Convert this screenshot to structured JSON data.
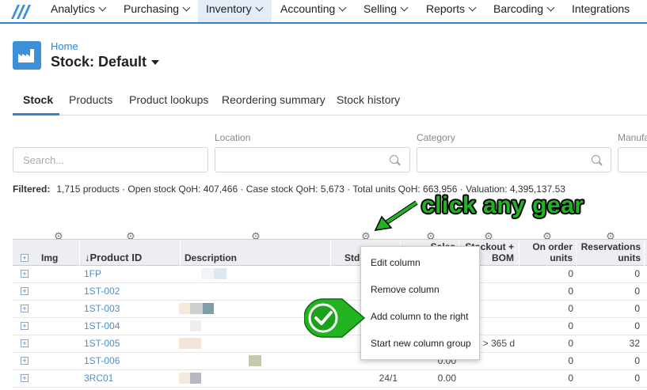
{
  "nav": {
    "items": [
      {
        "label": "Analytics"
      },
      {
        "label": "Purchasing"
      },
      {
        "label": "Inventory"
      },
      {
        "label": "Accounting"
      },
      {
        "label": "Selling"
      },
      {
        "label": "Reports"
      },
      {
        "label": "Barcoding"
      },
      {
        "label": "Integrations"
      }
    ]
  },
  "header": {
    "breadcrumb": "Home",
    "title": "Stock: Default"
  },
  "tabs": [
    {
      "label": "Stock"
    },
    {
      "label": "Products"
    },
    {
      "label": "Product lookups"
    },
    {
      "label": "Reordering summary"
    },
    {
      "label": "Stock history"
    }
  ],
  "filters": {
    "search_placeholder": "Search...",
    "location_label": "Location",
    "category_label": "Category",
    "manufacturer_label": "Manufa"
  },
  "summary": {
    "label": "Filtered:",
    "text": "1,715 products · Open stock QoH: 407,466 · Case stock QoH: 5,673 · Total units QoH: 663,956 · Valuation: 4,395,137.53"
  },
  "table": {
    "headers": {
      "img": "Img",
      "product_id": "↓Product ID",
      "description": "Description",
      "std": "Std",
      "sales": "Sales",
      "stockout": "Stockout +",
      "bom": "BOM",
      "on_order": "On order",
      "on_order_units": "units",
      "reservations": "Reservations",
      "reservations_units": "units"
    },
    "rows": [
      {
        "id": "1FP",
        "std": "",
        "sales": "",
        "stockout": "",
        "on_order": "0",
        "reservations": "0"
      },
      {
        "id": "1ST-002",
        "std": "",
        "sales": "",
        "stockout": "",
        "on_order": "0",
        "reservations": "0"
      },
      {
        "id": "1ST-003",
        "std": "",
        "sales": "",
        "stockout": "",
        "on_order": "0",
        "reservations": "0"
      },
      {
        "id": "1ST-004",
        "std": "",
        "sales": "",
        "stockout": "",
        "on_order": "0",
        "reservations": "0"
      },
      {
        "id": "1ST-005",
        "std": "",
        "sales": "",
        "stockout": "> 365 d",
        "on_order": "0",
        "reservations": "32"
      },
      {
        "id": "1ST-006",
        "std": "",
        "sales": "0.00",
        "stockout": "",
        "on_order": "0",
        "reservations": "0"
      },
      {
        "id": "3RC01",
        "std": "24/1",
        "sales": "0.00",
        "stockout": "",
        "on_order": "0",
        "reservations": "0"
      }
    ]
  },
  "context_menu": {
    "items": [
      {
        "label": "Edit column"
      },
      {
        "label": "Remove column"
      },
      {
        "label": "Add column to the right"
      },
      {
        "label": "Start new column group"
      }
    ]
  },
  "annotation": {
    "text": "click any gear",
    "color": "#22b322"
  },
  "colors": {
    "accent": "#2f80d1",
    "link": "#4b8fd0"
  }
}
